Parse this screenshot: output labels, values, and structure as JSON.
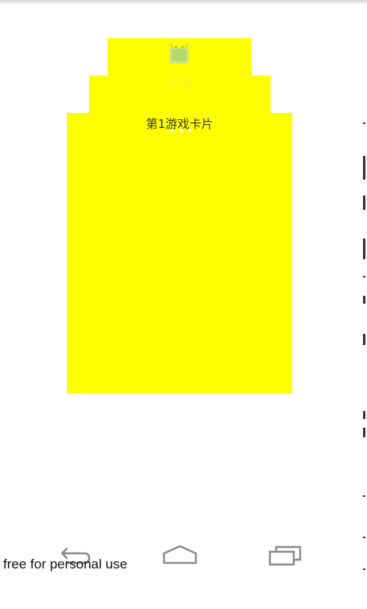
{
  "cards": {
    "front_title": "第1游戏卡片",
    "mid_text": "ⓥ ⓧ",
    "card_color": "#ffff00"
  },
  "icons": {
    "card_icon": "android-icon",
    "back": "back-icon",
    "home": "home-icon",
    "recent": "recent-apps-icon"
  },
  "watermark": "free for personal use"
}
